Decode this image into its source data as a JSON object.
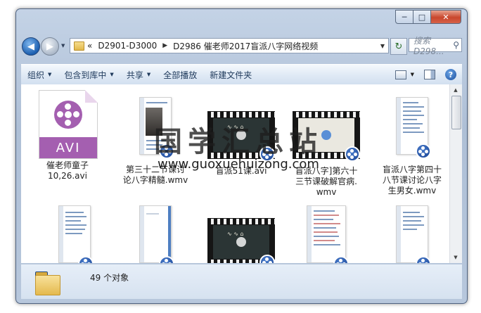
{
  "window": {
    "minimize": "─",
    "maximize": "□",
    "close": "✕"
  },
  "nav": {
    "back_glyph": "◀",
    "forward_glyph": "▶",
    "history_glyph": "▼",
    "breadcrumb_prefix": "«",
    "path": [
      "D2901-D3000",
      "D2986 催老师2017盲派八字网络视频"
    ],
    "breadcrumb_sep": "▶",
    "addr_dropdown": "▼",
    "refresh_glyph": "↻",
    "search_placeholder": "搜索 D298...",
    "search_icon": "⚲"
  },
  "toolbar": {
    "items": [
      "组织",
      "包含到库中",
      "共享",
      "全部播放",
      "新建文件夹"
    ],
    "arrow": "▼",
    "help": "?"
  },
  "files": [
    {
      "label": "催老师童子\n10,26.avi",
      "kind": "avi",
      "badge_text": "AVI"
    },
    {
      "label": "第三十二节课讨\n论八字精髓.wmv",
      "kind": "doc-photo"
    },
    {
      "label": "盲派51课.avi",
      "kind": "film-dark"
    },
    {
      "label": "盲派八字]第六十\n三节课破解官病.\nwmv",
      "kind": "film-light"
    },
    {
      "label": "盲派八字第四十\n八节课讨论八字\n生男女.wmv",
      "kind": "doc-blue"
    },
    {
      "label": "",
      "kind": "doc-blue"
    },
    {
      "label": "",
      "kind": "doc-plain"
    },
    {
      "label": "",
      "kind": "film-dark"
    },
    {
      "label": "",
      "kind": "doc-red"
    },
    {
      "label": "",
      "kind": "doc-plain"
    }
  ],
  "status": {
    "count": "49 个对象"
  },
  "watermark": {
    "cn": "国学汇总站",
    "url": "www.guoxuehuizong.com"
  },
  "scrollbar": {
    "up": "▲",
    "down": "▼"
  }
}
